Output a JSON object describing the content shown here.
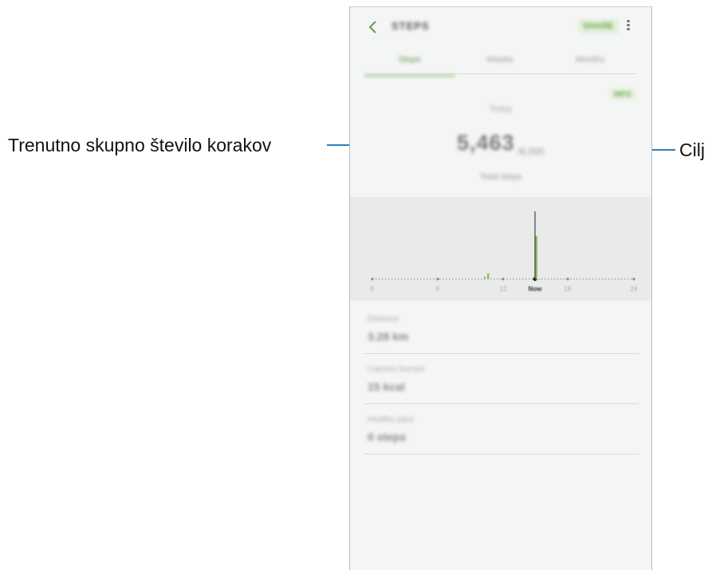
{
  "callouts": {
    "left_label": "Trenutno skupno število korakov",
    "right_label": "Cilj"
  },
  "colors": {
    "accent": "#8bbd6b",
    "callout_line": "#2a7fc0"
  },
  "appbar": {
    "title": "STEPS",
    "share_label": "SHARE",
    "back_icon": "chevron-left-icon",
    "more_icon": "more-vertical-icon"
  },
  "tabs": [
    {
      "label": "Steps",
      "active": true
    },
    {
      "label": "Weeks",
      "active": false
    },
    {
      "label": "Months",
      "active": false
    }
  ],
  "date_pill": "INFO",
  "period_label": "Today",
  "step_count": "5,463",
  "step_goal": "/6,000",
  "total_steps_label": "Total steps",
  "chart_data": {
    "type": "bar",
    "categories": [
      "0",
      "6",
      "12",
      "Now",
      "18",
      "24"
    ],
    "values": [
      0,
      0,
      4,
      30,
      0,
      0
    ],
    "highlight_index": 3,
    "title": "",
    "xlabel": "",
    "ylabel": ""
  },
  "stats": [
    {
      "label": "Distance",
      "value": "3.28 km"
    },
    {
      "label": "Calories burned",
      "value": "15 kcal"
    },
    {
      "label": "Healthy pace",
      "value": "0 steps"
    }
  ]
}
